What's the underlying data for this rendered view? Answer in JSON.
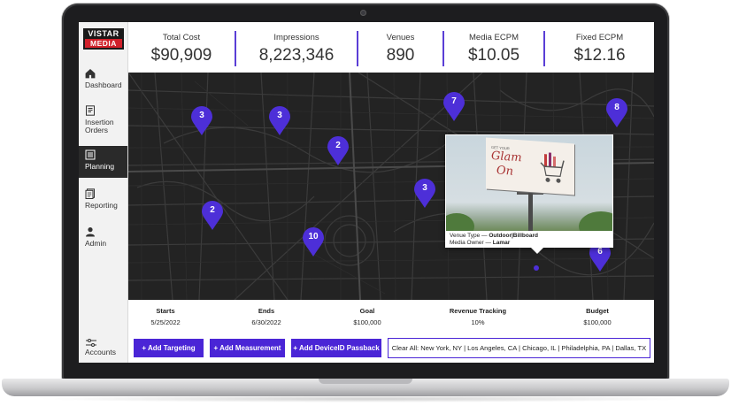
{
  "brand": {
    "top": "VISTAR",
    "bottom": "MEDIA",
    "accent_color": "#4a25d6",
    "logo_red": "#d0202a"
  },
  "sidebar": {
    "items": [
      {
        "label": "Dashboard",
        "icon": "home-icon"
      },
      {
        "label": "Insertion Orders",
        "icon": "document-icon"
      },
      {
        "label": "Planning",
        "icon": "list-icon",
        "active": true
      },
      {
        "label": "Reporting",
        "icon": "reports-icon"
      },
      {
        "label": "Admin",
        "icon": "user-icon"
      },
      {
        "label": "Accounts",
        "icon": "sliders-icon"
      }
    ]
  },
  "stats": [
    {
      "label": "Total Cost",
      "value": "$90,909"
    },
    {
      "label": "Impressions",
      "value": "8,223,346"
    },
    {
      "label": "Venues",
      "value": "890"
    },
    {
      "label": "Media ECPM",
      "value": "$10.05"
    },
    {
      "label": "Fixed ECPM",
      "value": "$12.16"
    }
  ],
  "map": {
    "pins": [
      "3",
      "3",
      "2",
      "7",
      "8",
      "3",
      "2",
      "10",
      "6"
    ],
    "popup": {
      "billboard_small": "GET YOUR",
      "billboard_line1": "Glam",
      "billboard_line2": "On",
      "venue_type_label": "Venue Type —",
      "venue_type_value": "Outdoor|Billboard",
      "media_owner_label": "Media Owner —",
      "media_owner_value": "Lamar"
    }
  },
  "details": [
    {
      "label": "Starts",
      "value": "5/25/2022"
    },
    {
      "label": "Ends",
      "value": "6/30/2022"
    },
    {
      "label": "Goal",
      "value": "$100,000"
    },
    {
      "label": "Revenue Tracking",
      "value": "10%"
    },
    {
      "label": "Budget",
      "value": "$100,000"
    }
  ],
  "actions": {
    "add_targeting": "+ Add Targeting",
    "add_measurement": "+ Add Measurement",
    "add_passback": "+ Add DeviceID Passback",
    "clear_all": "Clear All: New York, NY | Los Angeles, CA | Chicago, IL | Philadelphia, PA | Dallas, TX"
  }
}
